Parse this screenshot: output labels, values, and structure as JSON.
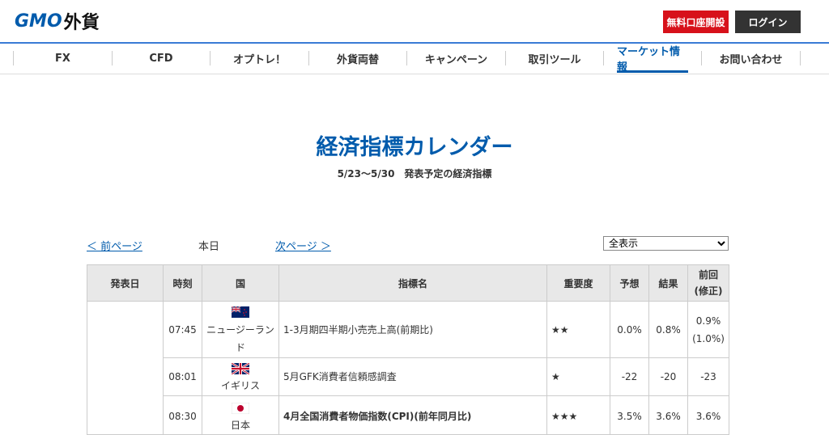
{
  "header": {
    "logo_gmo": "GMO",
    "logo_gaika": "外貨",
    "open_account": "無料口座開設",
    "login": "ログイン"
  },
  "nav": {
    "items": [
      {
        "label": "FX"
      },
      {
        "label": "CFD"
      },
      {
        "label": "オプトレ！"
      },
      {
        "label": "外貨両替"
      },
      {
        "label": "キャンペーン"
      },
      {
        "label": "取引ツール"
      },
      {
        "label": "マーケット情報",
        "active": true
      },
      {
        "label": "お問い合わせ"
      }
    ]
  },
  "page": {
    "title": "経済指標カレンダー",
    "subtitle": "5/23〜5/30　発表予定の経済指標"
  },
  "pager": {
    "prev": "＜ 前ページ",
    "today": "本日",
    "next": "次ページ ＞"
  },
  "filter": {
    "selected": "全表示"
  },
  "table": {
    "headers": {
      "date": "発表日",
      "time": "時刻",
      "country": "国",
      "indicator": "指標名",
      "importance": "重要度",
      "forecast": "予想",
      "result": "結果",
      "previous_line1": "前回",
      "previous_line2": "(修正)"
    },
    "rows": [
      {
        "time": "07:45",
        "country": "ニュージーランド",
        "flag": "nz-flag-icon",
        "indicator": "1-3月期四半期小売売上高(前期比)",
        "importance": "★★",
        "forecast": "0.0%",
        "result": "0.8%",
        "previous": "0.9%",
        "previous_revised": "(1.0%)"
      },
      {
        "time": "08:01",
        "country": "イギリス",
        "flag": "uk-flag-icon",
        "indicator": "5月GFK消費者信頼感調査",
        "importance": "★",
        "forecast": "-22",
        "result": "-20",
        "previous": "-23",
        "previous_revised": ""
      },
      {
        "time": "08:30",
        "country": "日本",
        "flag": "jp-flag-icon",
        "indicator": "4月全国消費者物価指数(CPI)(前年同月比)",
        "importance": "★★★",
        "forecast": "3.5%",
        "result": "3.6%",
        "previous": "3.6%",
        "previous_revised": ""
      }
    ]
  },
  "colors": {
    "brand_blue": "#005bac",
    "accent_red": "#d7111a",
    "indicator_red": "#c8242b"
  }
}
